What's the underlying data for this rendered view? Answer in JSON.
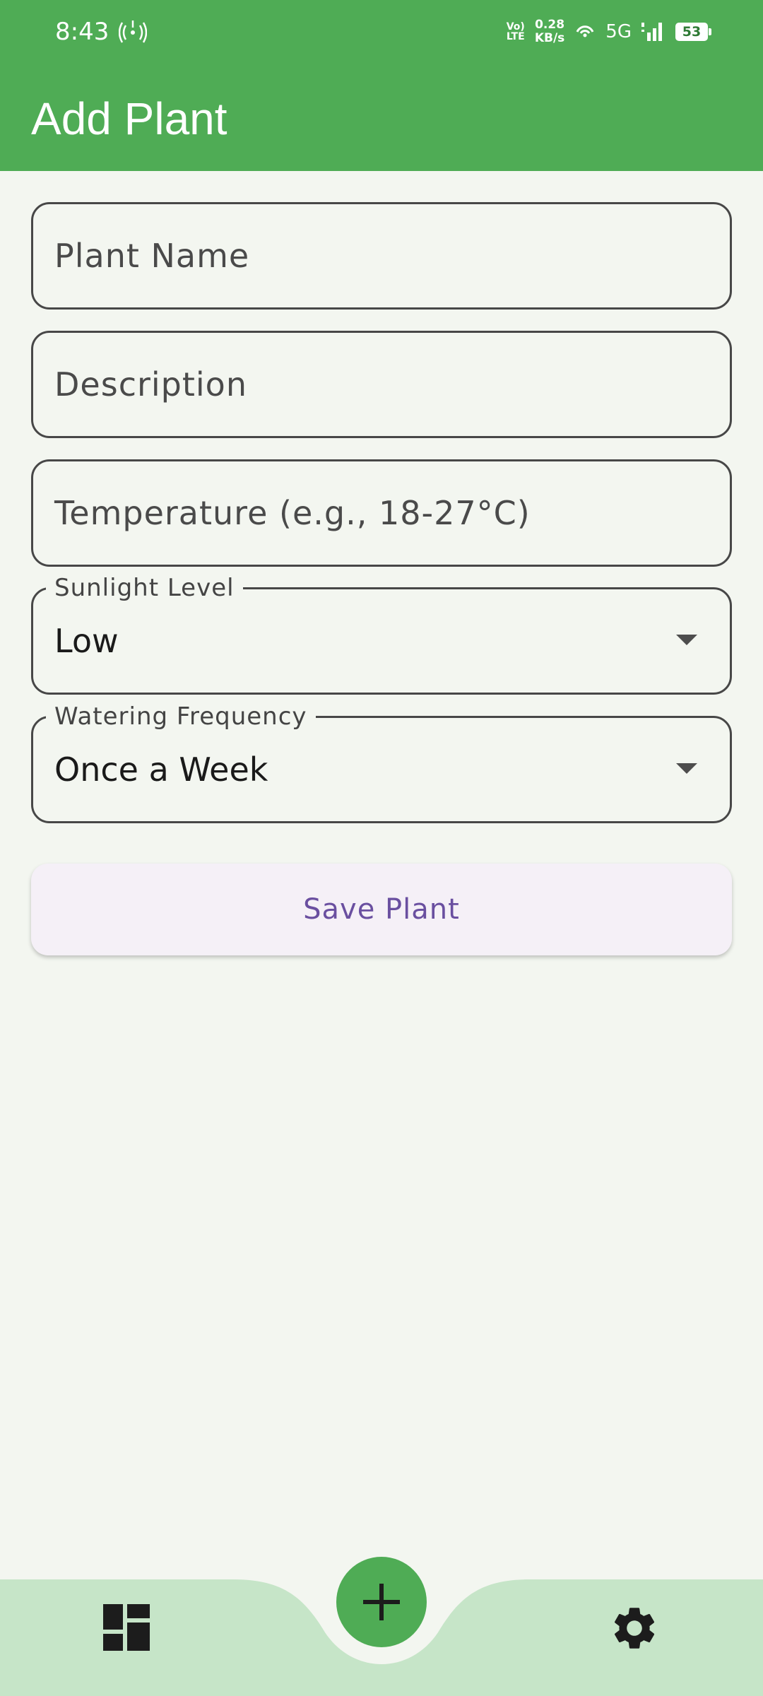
{
  "status_bar": {
    "time": "8:43",
    "volte_top": "Vo)",
    "volte_bottom": "LTE",
    "speed_value": "0.28",
    "speed_unit": "KB/s",
    "network": "5G",
    "battery": "53"
  },
  "app_bar": {
    "title": "Add Plant"
  },
  "form": {
    "plant_name_placeholder": "Plant Name",
    "description_placeholder": "Description",
    "temperature_placeholder": "Temperature (e.g., 18-27°C)",
    "sunlight_label": "Sunlight Level",
    "sunlight_value": "Low",
    "watering_label": "Watering Frequency",
    "watering_value": "Once a Week",
    "save_label": "Save Plant"
  },
  "bottom_nav": {
    "items": [
      {
        "icon": "dashboard-icon"
      },
      {
        "icon": "add-icon"
      },
      {
        "icon": "settings-icon"
      }
    ]
  },
  "colors": {
    "primary": "#4fac55",
    "background": "#f3f6f0",
    "nav_background": "#c6e5c8",
    "button_text": "#6a4fa0",
    "button_background": "#f5f0f7"
  }
}
